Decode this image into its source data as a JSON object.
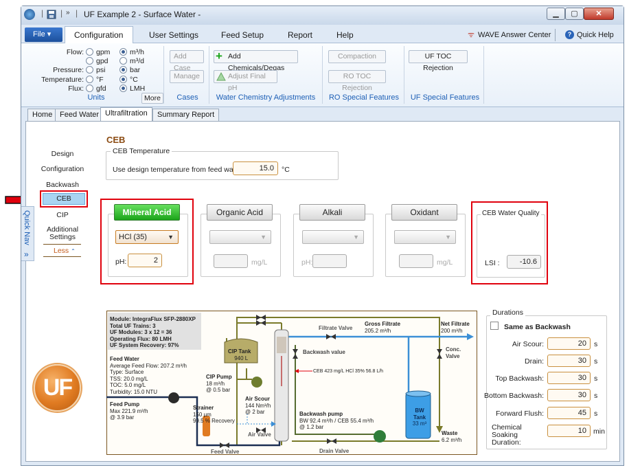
{
  "window": {
    "title": "UF Example 2 - Surface Water -"
  },
  "menu": {
    "file": "File",
    "items": [
      "Configuration",
      "User Settings",
      "Feed Setup",
      "Report",
      "Help"
    ],
    "wave_center": "WAVE Answer Center",
    "quick_help": "Quick Help"
  },
  "units": {
    "labels": [
      "Flow:",
      "Pressure:",
      "Temperature:",
      "Flux:"
    ],
    "flow_a": "gpm",
    "flow_b": "m³/h",
    "flow_c": "gpd",
    "flow_d": "m³/d",
    "pressure_a": "psi",
    "pressure_b": "bar",
    "temp_a": "°F",
    "temp_b": "°C",
    "flux_a": "gfd",
    "flux_b": "LMH",
    "more": "More",
    "group": "Units"
  },
  "ribbon": {
    "add_case": "Add Case",
    "manage": "Manage",
    "cases": "Cases",
    "add_chem": "Add Chemicals/Degas",
    "adjust_ph": "Adjust Final pH",
    "wca": "Water Chemistry Adjustments",
    "compaction": "Compaction",
    "ro_toc": "RO TOC Rejection",
    "ro_special": "RO Special Features",
    "uf_toc": "UF TOC Rejection",
    "uf_special": "UF Special Features"
  },
  "tabs": [
    "Home",
    "Feed Water",
    "Ultrafiltration",
    "Summary Report"
  ],
  "quicknav": {
    "label": "Quick Nav",
    "items": [
      "Design",
      "Configuration",
      "Backwash",
      "CEB",
      "CIP",
      "Additional Settings"
    ],
    "less": "Less"
  },
  "ceb": {
    "title": "CEB",
    "temp_group": "CEB Temperature",
    "temp_label": "Use design temperature from feed water:",
    "temp_value": "15.0",
    "temp_unit": "°C",
    "chem_buttons": [
      "Mineral Acid",
      "Organic Acid",
      "Alkali",
      "Oxidant"
    ],
    "mineral_select": "HCl (35)",
    "ph_label": "pH:",
    "ph_value": "2",
    "mgl": "mg/L",
    "water_quality": "CEB Water Quality",
    "lsi_label": "LSI :",
    "lsi_value": "-10.6"
  },
  "diagram": {
    "module": [
      "Module: IntegraFlux SFP-2880XP",
      "Total UF Trains: 3",
      "UF Modules: 3 x 12  =  36",
      "Operating Flux: 80 LMH",
      "UF System Recovery: 97%"
    ],
    "feed_water": [
      "Feed Water",
      "Average Feed Flow: 207.2 m³/h",
      "Type: Surface",
      "TSS: 20.0 mg/L",
      "TOC:  5.0 mg/L",
      "Turbidity: 15.0 NTU"
    ],
    "feed_pump": [
      "Feed Pump",
      "Max 221.9 m³/h",
      "@ 3.9 bar"
    ],
    "strainer": [
      "Strainer",
      "150 µm",
      "99.5 % Recovery"
    ],
    "cip_tank": [
      "CIP Tank",
      "940 L"
    ],
    "cip_pump": [
      "CIP Pump",
      "18 m³/h",
      "@ 0.5 bar"
    ],
    "air_scour": [
      "Air Scour",
      "144 Nm³/h",
      "@ 2 bar"
    ],
    "air_valve": "Air Valve",
    "feed_valve": "Feed Valve",
    "filtrate_valve": "Filtrate Valve",
    "gross_filtrate": [
      "Gross Filtrate",
      "205.2 m³/h"
    ],
    "net_filtrate": [
      "Net Filtrate",
      "200 m³/h"
    ],
    "backwash_value": "Backwash value",
    "conc_valve": [
      "Conc.",
      "Valve"
    ],
    "ceb_dose": "CEB 423 mg/L HCl 35% 56.8 L/h",
    "bw_pump": [
      "Backwash pump",
      "BW 92.4 m³/h / CEB 55.4 m³/h",
      "@ 1.2 bar"
    ],
    "bw_tank": [
      "BW",
      "Tank",
      "33 m³"
    ],
    "waste": [
      "Waste",
      "6.2 m³/h"
    ],
    "drain_valve": "Drain Valve",
    "logo": "UF"
  },
  "durations": {
    "title": "Durations",
    "same_as_backwash": "Same as Backwash",
    "rows": [
      {
        "label": "Air Scour:",
        "value": "20",
        "unit": "s"
      },
      {
        "label": "Drain:",
        "value": "30",
        "unit": "s"
      },
      {
        "label": "Top Backwash:",
        "value": "30",
        "unit": "s"
      },
      {
        "label": "Bottom Backwash:",
        "value": "30",
        "unit": "s"
      },
      {
        "label": "Forward Flush:",
        "value": "45",
        "unit": "s"
      },
      {
        "label": "Chemical Soaking Duration:",
        "value": "10",
        "unit": "min"
      }
    ]
  },
  "colors": {
    "accent": "#1d5fb5",
    "green": "#1ba41a",
    "red": "#e0000c",
    "orange": "#e07b22",
    "pipe_blue": "#3b8fd6",
    "pipe_olive": "#7a7a2a"
  }
}
